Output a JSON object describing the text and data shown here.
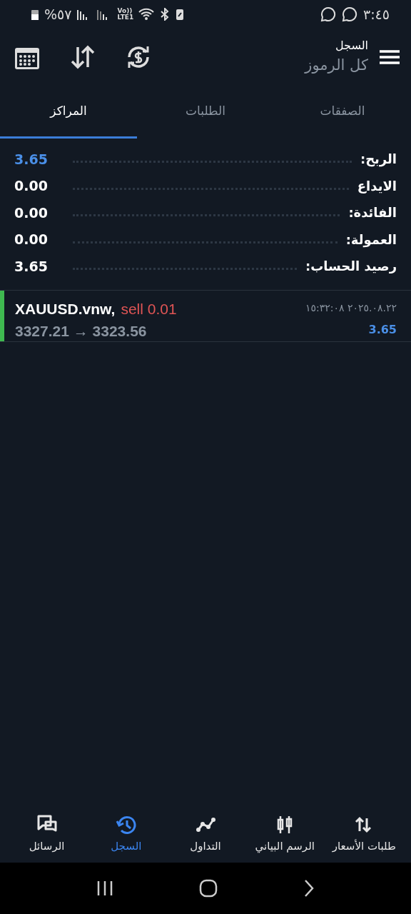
{
  "status_bar": {
    "time": "٣:٤٥",
    "battery": "%٥٧",
    "network": "Vo)) LTE1"
  },
  "header": {
    "title": "السجل",
    "subtitle": "كل الرموز"
  },
  "tabs": [
    {
      "label": "الصفقات",
      "selected": false
    },
    {
      "label": "الطلبات",
      "selected": false
    },
    {
      "label": "المراكز",
      "selected": true
    }
  ],
  "summary": [
    {
      "label": "الربح:",
      "value": "3.65",
      "color": "#4a8fe7"
    },
    {
      "label": "الايداع",
      "value": "0.00",
      "color": "#ffffff"
    },
    {
      "label": "الفائدة:",
      "value": "0.00",
      "color": "#ffffff"
    },
    {
      "label": "العمولة:",
      "value": "0.00",
      "color": "#ffffff"
    },
    {
      "label": "رصيد الحساب:",
      "value": "3.65",
      "color": "#ffffff"
    }
  ],
  "deals": [
    {
      "symbol": "XAUUSD.vnw,",
      "order": "sell 0.01",
      "kind": "sell",
      "prices": "3327.21 → 3323.56",
      "time": "١٥:٣٢:٠٨ ٢٠٢٥.٠٨.٢٢",
      "profit": "3.65",
      "color": "#3fb950"
    }
  ],
  "bottom_nav": [
    {
      "label": "طلبات الأسعار",
      "selected": false
    },
    {
      "label": "الرسم البياني",
      "selected": false
    },
    {
      "label": "التداول",
      "selected": false
    },
    {
      "label": "السجل",
      "selected": true
    },
    {
      "label": "الرسائل",
      "selected": false
    }
  ]
}
